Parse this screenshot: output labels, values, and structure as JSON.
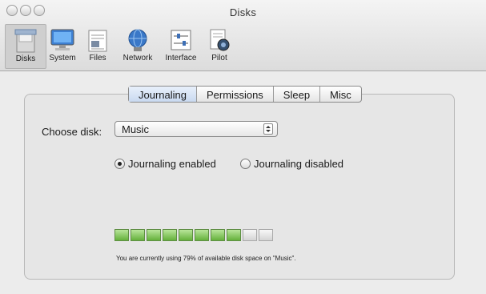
{
  "window": {
    "title": "Disks"
  },
  "toolbar": {
    "items": [
      {
        "label": "Disks",
        "icon": "disk-icon",
        "selected": true
      },
      {
        "label": "System",
        "icon": "monitor-icon",
        "selected": false
      },
      {
        "label": "Files",
        "icon": "files-icon",
        "selected": false
      },
      {
        "label": "Network",
        "icon": "globe-icon",
        "selected": false
      },
      {
        "label": "Interface",
        "icon": "sliders-icon",
        "selected": false
      },
      {
        "label": "Pilot",
        "icon": "pilot-icon",
        "selected": false
      }
    ]
  },
  "tabs": [
    {
      "label": "Journaling",
      "active": true
    },
    {
      "label": "Permissions",
      "active": false
    },
    {
      "label": "Sleep",
      "active": false
    },
    {
      "label": "Misc",
      "active": false
    }
  ],
  "disk": {
    "choose_label": "Choose disk:",
    "selected": "Music"
  },
  "journaling": {
    "enabled_label": "Journaling enabled",
    "disabled_label": "Journaling disabled",
    "selected": "enabled"
  },
  "usage": {
    "segments_total": 10,
    "segments_filled": 8,
    "percent": 79,
    "text": "You are currently using 79% of available disk space on \"Music\"."
  },
  "colors": {
    "gauge_fill": "#64b13b",
    "tab_active": "#c9d9f0"
  }
}
